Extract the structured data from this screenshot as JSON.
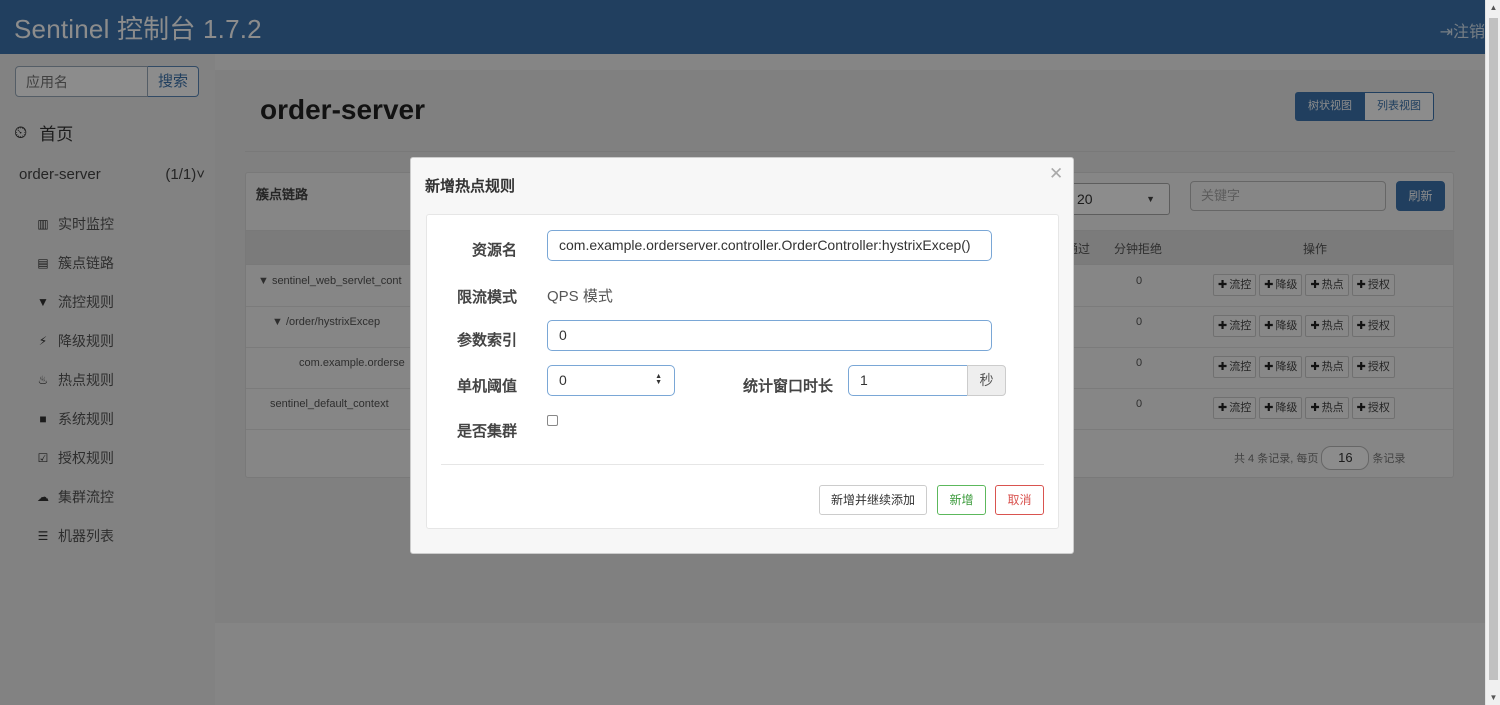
{
  "header": {
    "title": "Sentinel 控制台 1.7.2",
    "logout": "⇥注销"
  },
  "sidebar": {
    "search_placeholder": "应用名",
    "search_button": "搜索",
    "home": "首页",
    "app_name": "order-server",
    "app_count": "(1/1)",
    "items": [
      {
        "icon": "bar-chart-icon",
        "label": "实时监控"
      },
      {
        "icon": "list-icon",
        "label": "簇点链路"
      },
      {
        "icon": "filter-icon",
        "label": "流控规则"
      },
      {
        "icon": "bolt-icon",
        "label": "降级规则"
      },
      {
        "icon": "fire-icon",
        "label": "热点规则"
      },
      {
        "icon": "lock-icon",
        "label": "系统规则"
      },
      {
        "icon": "check-icon",
        "label": "授权规则"
      },
      {
        "icon": "cloud-icon",
        "label": "集群流控"
      },
      {
        "icon": "th-list-icon",
        "label": "机器列表"
      }
    ]
  },
  "main": {
    "title": "order-server",
    "view_tree": "树状视图",
    "view_list": "列表视图",
    "panel_title": "簇点链路",
    "page_size": "20",
    "keyword_placeholder": "关键字",
    "refresh": "刷新",
    "columns": {
      "passed": "通过",
      "reject": "分钟拒绝",
      "ops": "操作"
    },
    "ops": [
      "流控",
      "降级",
      "热点",
      "授权"
    ],
    "rows": [
      {
        "name": "▼ sentinel_web_servlet_cont",
        "reject": "0"
      },
      {
        "name": "▼ /order/hystrixExcep",
        "reject": "0"
      },
      {
        "name": "com.example.orderse",
        "reject": "0"
      },
      {
        "name": "sentinel_default_context",
        "reject": "0"
      }
    ],
    "pager": {
      "prefix": "共 4 条记录, 每页",
      "size": "16",
      "suffix": "条记录"
    }
  },
  "modal": {
    "title": "新增热点规则",
    "resource_label": "资源名",
    "resource_value": "com.example.orderserver.controller.OrderController:hystrixExcep()",
    "mode_label": "限流模式",
    "mode_value": "QPS 模式",
    "index_label": "参数索引",
    "index_value": "0",
    "threshold_label": "单机阈值",
    "threshold_value": "0",
    "window_label": "统计窗口时长",
    "window_value": "1",
    "window_unit": "秒",
    "cluster_label": "是否集群",
    "cluster_checked": false,
    "btn_add_continue": "新增并继续添加",
    "btn_add": "新增",
    "btn_cancel": "取消"
  }
}
